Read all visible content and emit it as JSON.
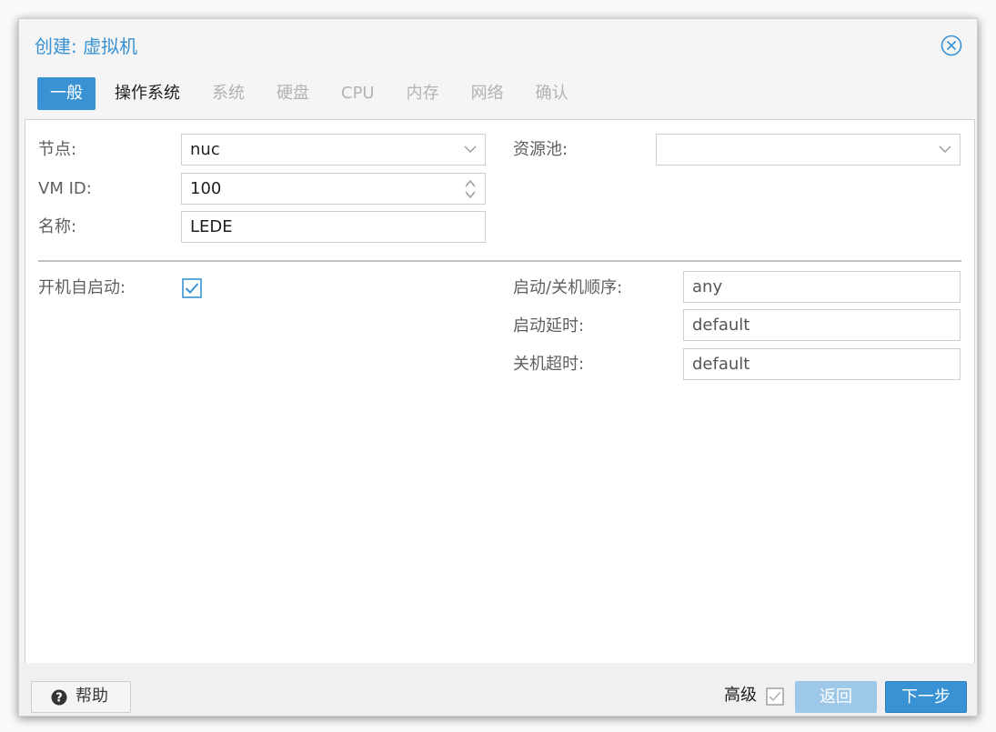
{
  "dialog": {
    "title": "创建: 虚拟机"
  },
  "tabs": [
    {
      "label": "一般",
      "state": "active"
    },
    {
      "label": "操作系统",
      "state": "enabled"
    },
    {
      "label": "系统",
      "state": "disabled"
    },
    {
      "label": "硬盘",
      "state": "disabled"
    },
    {
      "label": "CPU",
      "state": "disabled"
    },
    {
      "label": "内存",
      "state": "disabled"
    },
    {
      "label": "网络",
      "state": "disabled"
    },
    {
      "label": "确认",
      "state": "disabled"
    }
  ],
  "form": {
    "node": {
      "label": "节点:",
      "value": "nuc"
    },
    "vmid": {
      "label": "VM ID:",
      "value": "100"
    },
    "name": {
      "label": "名称:",
      "value": "LEDE"
    },
    "pool": {
      "label": "资源池:",
      "value": ""
    },
    "onboot": {
      "label": "开机自启动:",
      "checked": true
    },
    "startup_order": {
      "label": "启动/关机顺序:",
      "placeholder": "any"
    },
    "startup_delay": {
      "label": "启动延时:",
      "placeholder": "default"
    },
    "shutdown_timeout": {
      "label": "关机超时:",
      "placeholder": "default"
    }
  },
  "footer": {
    "help_label": "帮助",
    "advanced_label": "高级",
    "advanced_checked": false,
    "back_label": "返回",
    "next_label": "下一步"
  },
  "icons": {
    "close": "close-circle-icon",
    "help": "question-circle-icon",
    "dropdown": "chevron-down-icon",
    "spinner": "spinner-arrows-icon",
    "checkbox": "checkbox-icon"
  },
  "colors": {
    "accent": "#3892d4",
    "accent_disabled": "#9ec8e8",
    "tab_disabled_text": "#b3b3b3"
  }
}
